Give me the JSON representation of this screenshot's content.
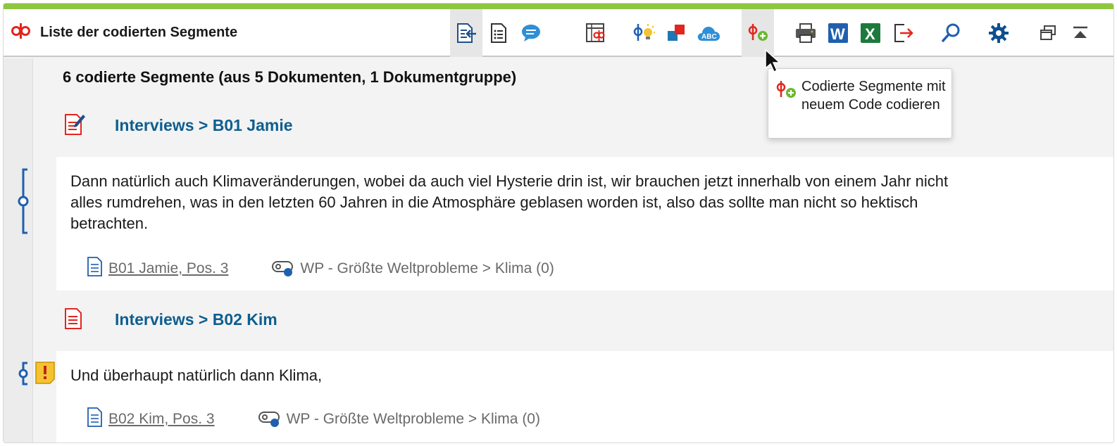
{
  "window": {
    "title": "Liste der codierten Segmente",
    "accent_color": "#8dc63f"
  },
  "toolbar": {
    "buttons": [
      {
        "name": "activate-document-icon",
        "active": true
      },
      {
        "name": "overview-list-icon"
      },
      {
        "name": "comment-icon"
      },
      {
        "name": "code-matrix-icon"
      },
      {
        "name": "code-idea-icon"
      },
      {
        "name": "color-code-icon"
      },
      {
        "name": "word-cloud-icon"
      },
      {
        "name": "code-with-new-code-icon",
        "active": true
      },
      {
        "name": "print-icon"
      },
      {
        "name": "word-export-icon"
      },
      {
        "name": "excel-export-icon"
      },
      {
        "name": "export-icon"
      },
      {
        "name": "search-icon"
      },
      {
        "name": "settings-icon"
      },
      {
        "name": "undock-window-icon"
      },
      {
        "name": "collapse-icon"
      }
    ]
  },
  "tooltip": {
    "text": "Codierte Segmente mit neuem Code codieren"
  },
  "summary": "6 codierte Segmente (aus 5 Dokumenten, 1 Dokumentgruppe)",
  "groups": [
    {
      "title": "Interviews > B01 Jamie",
      "segments": [
        {
          "text_lines": [
            "Dann natürlich auch Klimaveränderungen, wobei da auch viel Hysterie drin ist, wir brauchen jetzt innerhalb von einem Jahr nicht",
            "alles rumdrehen, was in den letzten 60 Jahren in die Atmosphäre geblasen worden ist, also das sollte man nicht so hektisch",
            "betrachten."
          ],
          "source": "B01 Jamie, Pos. 3",
          "code": "WP - Größte Weltprobleme > Klima (0)"
        }
      ]
    },
    {
      "title": "Interviews > B02 Kim",
      "segments": [
        {
          "text_lines": [
            "Und überhaupt natürlich dann Klima,"
          ],
          "source": "B02 Kim, Pos. 3",
          "code": "WP - Größte Weltprobleme > Klima (0)"
        }
      ]
    }
  ],
  "colors": {
    "code_red": "#e2261d",
    "doc_blue": "#0e5e8f",
    "memo_yellow": "#f4c430",
    "excel_green": "#1d7a3c",
    "word_blue": "#1f5fb0"
  }
}
